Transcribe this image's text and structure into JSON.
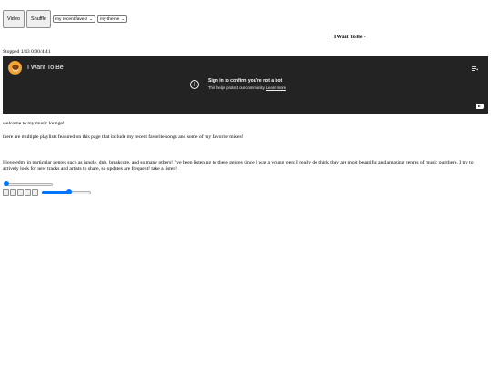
{
  "controls": {
    "video_label": "Video",
    "shuffle_label": "Shuffle",
    "playlist_select": "my recent faves!",
    "theme_select": "my-theme"
  },
  "now_playing": {
    "title": "I Want To Be -",
    "status": "Stopped 1/43 0:00/4:41"
  },
  "player": {
    "video_title": "I Want To Be",
    "message_title": "Sign in to confirm you're not a bot",
    "message_sub": "This helps protect our community.",
    "learn_more": "Learn more"
  },
  "content": {
    "welcome": "welcome to my music lounge!",
    "playlists": "there are multiple playlists featured on this page that include my recent favorite songs and some of my favorite mixes!",
    "about": "I love edm, in particular genres such as jungle, dnb, breakcore, and so many others! I've been listening to these genres since I was a young teen; I really do think they are most beautiful and amazing genres of music out there. I try to actively look for new tracks and artists to share, so updates are frequent! take a listen!"
  },
  "sliders": {
    "progress_fraction": 0.0,
    "volume_fraction": 0.55
  },
  "colors": {
    "accent": "#0075ff",
    "player_bg": "#232323"
  }
}
